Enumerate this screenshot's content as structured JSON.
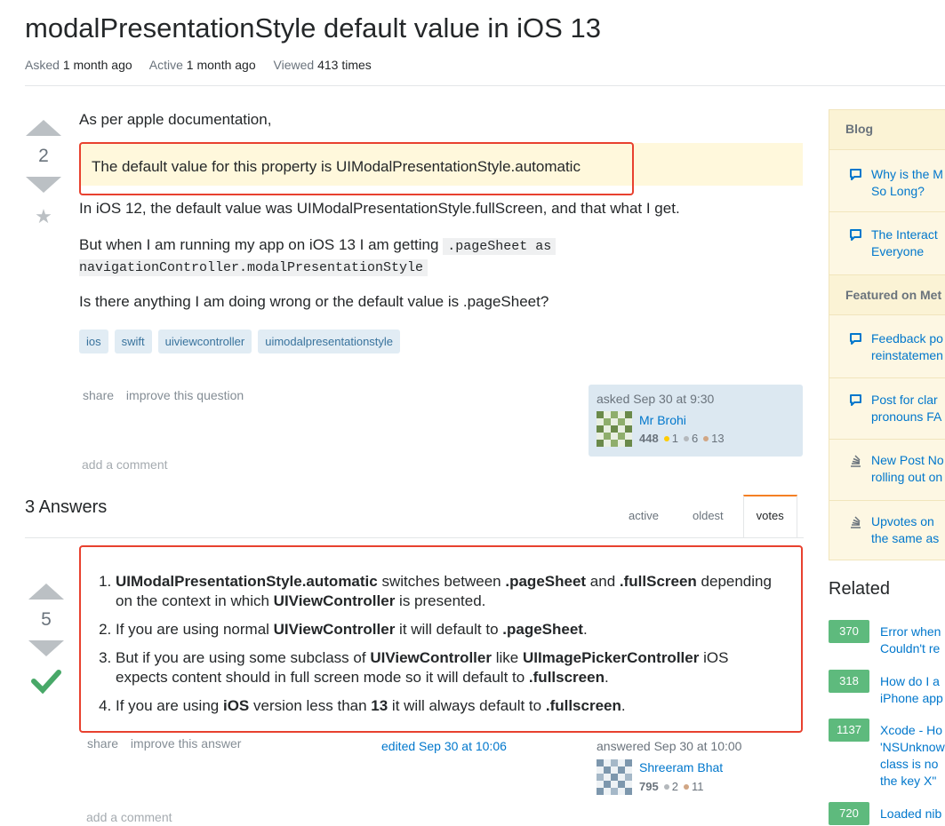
{
  "question": {
    "title": "modalPresentationStyle default value in iOS 13",
    "meta": {
      "asked_label": "Asked",
      "asked_value": "1 month ago",
      "active_label": "Active",
      "active_value": "1 month ago",
      "viewed_label": "Viewed",
      "viewed_value": "413 times"
    },
    "votes": "2",
    "intro": "As per apple documentation,",
    "quote": "The default value for this property is UIModalPresentationStyle.automatic",
    "p2": "In iOS 12, the default value was UIModalPresentationStyle.fullScreen, and that what I get.",
    "p3_prefix": "But when I am running my app on iOS 13 I am getting",
    "p3_code1": ".pageSheet as",
    "p3_code2": "navigationController.modalPresentationStyle",
    "p4": "Is there anything I am doing wrong or the default value is .pageSheet?",
    "tags": [
      "ios",
      "swift",
      "uiviewcontroller",
      "uimodalpresentationstyle"
    ],
    "menu": {
      "share": "share",
      "improve": "improve this question"
    },
    "owner": {
      "time": "asked Sep 30 at 9:30",
      "name": "Mr Brohi",
      "rep": "448",
      "gold": "1",
      "silver": "6",
      "bronze": "13"
    },
    "add_comment": "add a comment"
  },
  "answers_header": "3 Answers",
  "sort_tabs": [
    "active",
    "oldest",
    "votes"
  ],
  "answer": {
    "votes": "5",
    "items": [
      {
        "b1": "UIModalPresentationStyle.automatic",
        "t1": " switches between ",
        "b2": ".pageSheet",
        "t2": " and ",
        "b3": ".fullScreen",
        "t3": " depending on the context in which ",
        "b4": "UIViewController",
        "t4": " is presented."
      },
      {
        "t0": "If you are using normal ",
        "b1": "UIViewController",
        "t1": " it will default to ",
        "b2": ".pageSheet",
        "t2": "."
      },
      {
        "t0": "But if you are using some subclass of ",
        "b1": "UIViewController",
        "t1": " like ",
        "b2": "UIImagePickerController",
        "t2": " iOS expects content should in full screen mode so it will default to ",
        "b3": ".fullscreen",
        "t3": "."
      },
      {
        "t0": "If you are using ",
        "b1": "iOS",
        "t1": " version less than ",
        "b2": "13",
        "t2": " it will always default to ",
        "b3": ".fullscreen",
        "t3": "."
      }
    ],
    "menu": {
      "share": "share",
      "improve": "improve this answer"
    },
    "edited": "edited Sep 30 at 10:06",
    "owner": {
      "time": "answered Sep 30 at 10:00",
      "name": "Shreeram Bhat",
      "rep": "795",
      "silver": "2",
      "bronze": "11"
    },
    "add_comment": "add a comment"
  },
  "sidebar": {
    "blog_header": "Blog",
    "blog_items": [
      {
        "line1": "Why is the M",
        "line2": "So Long?",
        "icon": "chat-bubble-icon"
      },
      {
        "line1": "The Interact",
        "line2": "Everyone",
        "icon": "chat-bubble-icon"
      }
    ],
    "meta_header": "Featured on Met",
    "meta_items": [
      {
        "line1": "Feedback po",
        "line2": "reinstatemen",
        "icon": "chat-bubble-icon"
      },
      {
        "line1": "Post for clar",
        "line2": "pronouns FA",
        "icon": "chat-bubble-icon"
      },
      {
        "line1": "New Post No",
        "line2": "rolling out on",
        "icon": "stack-exchange-icon"
      },
      {
        "line1": "Upvotes on",
        "line2": "the same as",
        "icon": "stack-exchange-icon"
      }
    ]
  },
  "related": {
    "header": "Related",
    "items": [
      {
        "score": "370",
        "line1": "Error when",
        "line2": "Couldn't re"
      },
      {
        "score": "318",
        "line1": "How do I a",
        "line2": "iPhone app"
      },
      {
        "score": "1137",
        "line1": "Xcode - Ho",
        "line2": "'NSUnknow",
        "line3": "class is no",
        "line4": "the key X\""
      },
      {
        "score": "720",
        "line1": "Loaded nib"
      }
    ]
  },
  "colors": {
    "accent_link": "#0077cc",
    "highlight_box": "#e8412f",
    "quote_bg": "#fff8dc",
    "accepted": "#48a868"
  }
}
